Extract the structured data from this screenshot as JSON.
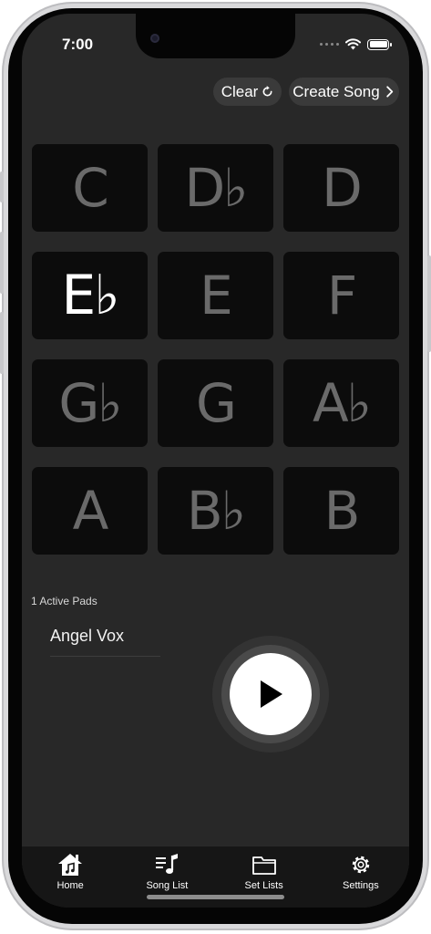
{
  "status_bar": {
    "time": "7:00"
  },
  "header": {
    "clear_label": "Clear",
    "create_song_label": "Create Song"
  },
  "keys": [
    {
      "label": "C",
      "active": false
    },
    {
      "label": "D♭",
      "active": false
    },
    {
      "label": "D",
      "active": false
    },
    {
      "label": "E♭",
      "active": true
    },
    {
      "label": "E",
      "active": false
    },
    {
      "label": "F",
      "active": false
    },
    {
      "label": "G♭",
      "active": false
    },
    {
      "label": "G",
      "active": false
    },
    {
      "label": "A♭",
      "active": false
    },
    {
      "label": "A",
      "active": false
    },
    {
      "label": "B♭",
      "active": false
    },
    {
      "label": "B",
      "active": false
    }
  ],
  "pads": {
    "active_label": "1 Active Pads",
    "sound_name": "Angel Vox"
  },
  "tabs": [
    {
      "label": "Home",
      "icon": "home-icon"
    },
    {
      "label": "Song List",
      "icon": "music-list-icon"
    },
    {
      "label": "Set Lists",
      "icon": "folder-icon"
    },
    {
      "label": "Settings",
      "icon": "gear-icon"
    }
  ],
  "colors": {
    "background": "#282828",
    "pad": "#0c0c0c",
    "pad_text_inactive": "#6a6a6a",
    "pad_text_active": "#ffffff",
    "tab_bar": "#161616"
  }
}
